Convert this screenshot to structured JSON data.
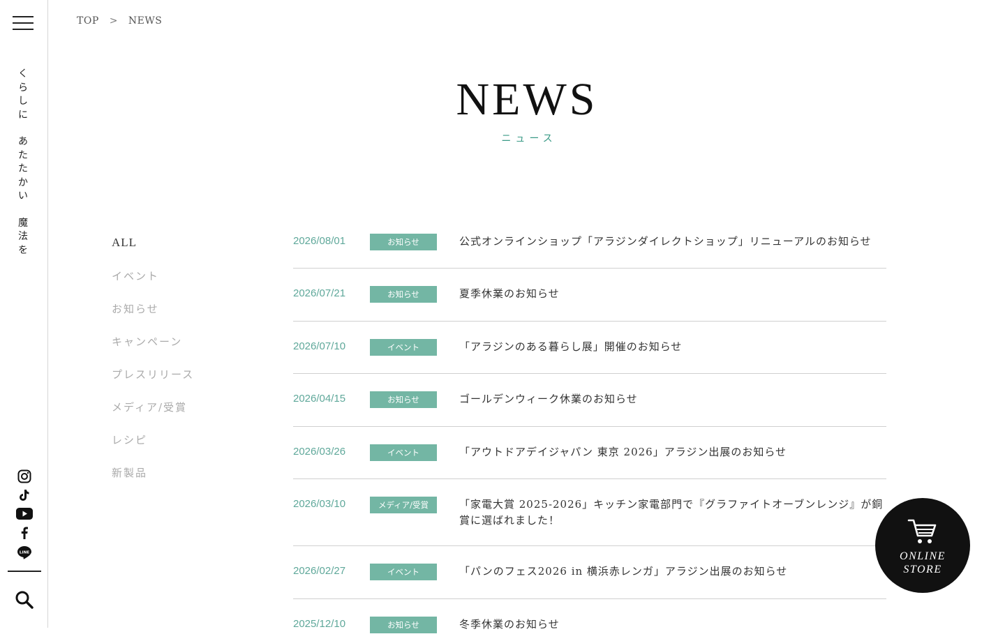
{
  "rail": {
    "tagline": [
      "くらしに",
      "あたたかい",
      "魔法を"
    ],
    "social_icons": [
      "instagram-icon",
      "tiktok-icon",
      "youtube-icon",
      "facebook-icon",
      "line-icon"
    ]
  },
  "breadcrumb": {
    "home": "TOP",
    "separator": ">",
    "current": "NEWS"
  },
  "header": {
    "title": "NEWS",
    "subtitle": "ニュース"
  },
  "categories": [
    {
      "label": "ALL",
      "active": true
    },
    {
      "label": "イベント"
    },
    {
      "label": "お知らせ"
    },
    {
      "label": "キャンペーン"
    },
    {
      "label": "プレスリリース"
    },
    {
      "label": "メディア/受賞"
    },
    {
      "label": "レシピ"
    },
    {
      "label": "新製品"
    }
  ],
  "news": [
    {
      "date": "2026/08/01",
      "tag": "お知らせ",
      "title": "公式オンラインショップ「アラジンダイレクトショップ」リニューアルのお知らせ"
    },
    {
      "date": "2026/07/21",
      "tag": "お知らせ",
      "title": "夏季休業のお知らせ"
    },
    {
      "date": "2026/07/10",
      "tag": "イベント",
      "title": "「アラジンのある暮らし展」開催のお知らせ"
    },
    {
      "date": "2026/04/15",
      "tag": "お知らせ",
      "title": "ゴールデンウィーク休業のお知らせ"
    },
    {
      "date": "2026/03/26",
      "tag": "イベント",
      "title": "「アウトドアデイジャパン 東京 2026」アラジン出展のお知らせ"
    },
    {
      "date": "2026/03/10",
      "tag": "メディア/受賞",
      "title": "「家電大賞 2025-2026」キッチン家電部門で『グラファイトオーブンレンジ』が銅賞に選ばれました！"
    },
    {
      "date": "2026/02/27",
      "tag": "イベント",
      "title": "「パンのフェス2026 in 横浜赤レンガ」アラジン出展のお知らせ"
    },
    {
      "date": "2025/12/10",
      "tag": "お知らせ",
      "title": "冬季休業のお知らせ"
    }
  ],
  "store_button": {
    "label": "ONLINE\nSTORE"
  },
  "colors": {
    "accent": "#73b6a4",
    "date": "#5fa89a",
    "store_bg": "#111111"
  }
}
